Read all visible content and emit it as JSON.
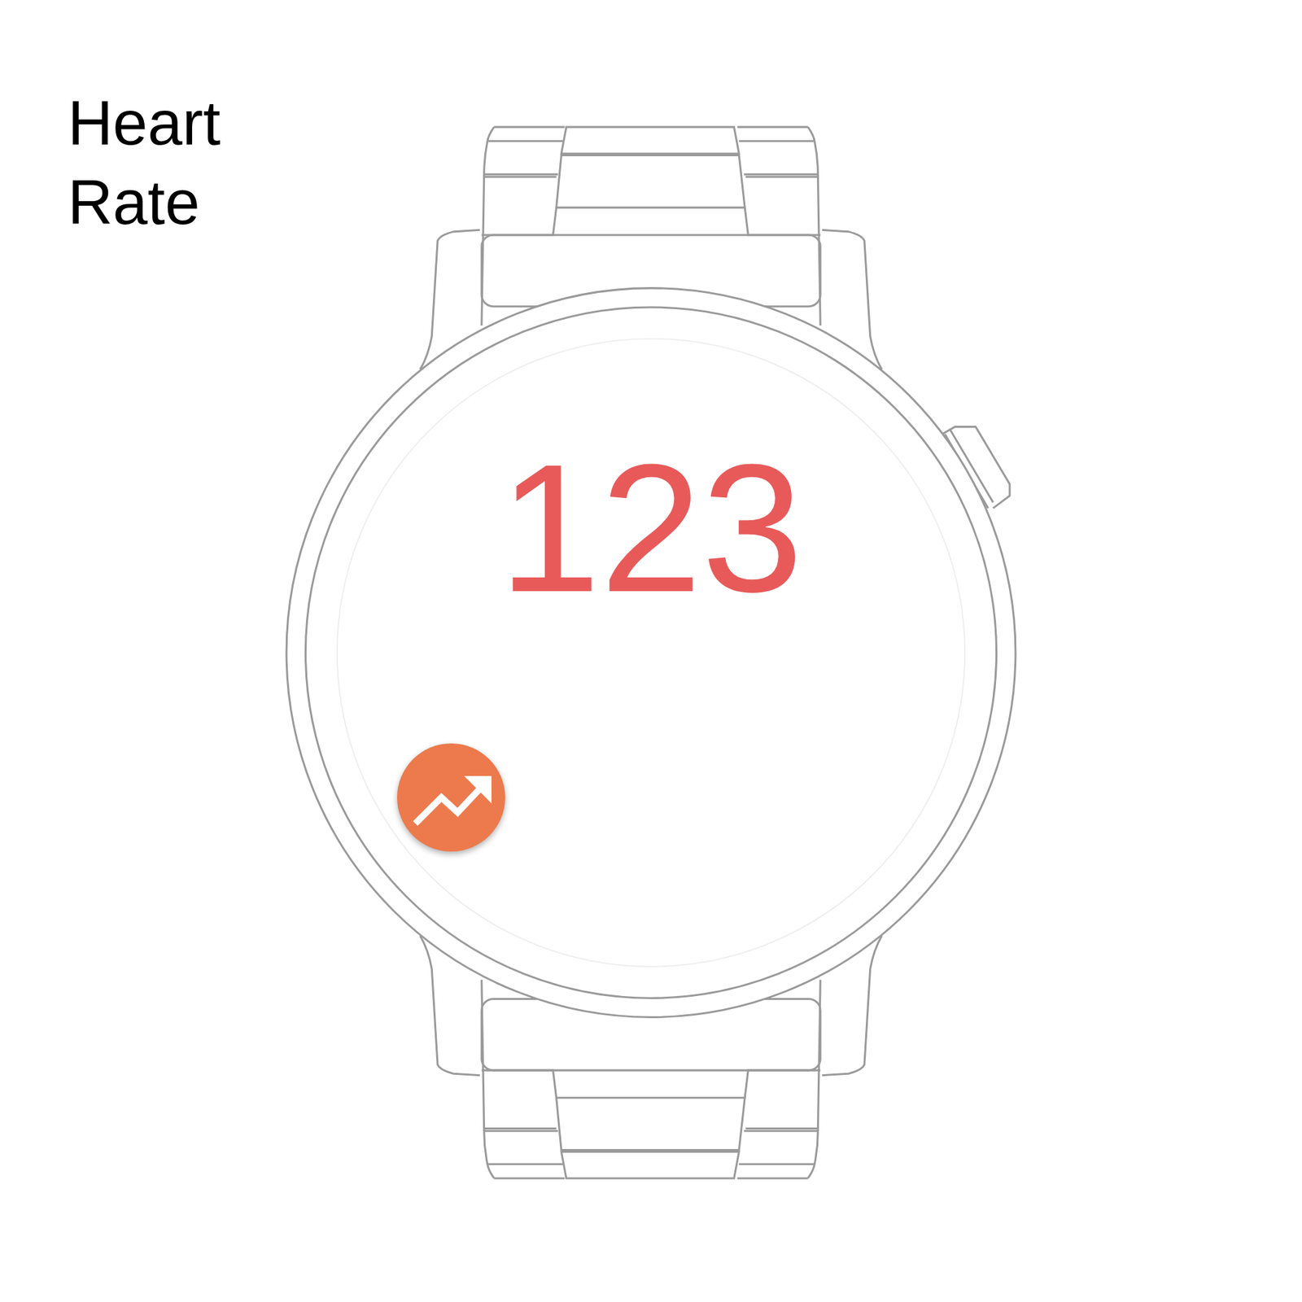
{
  "title": "Heart Rate",
  "heart_rate": {
    "value": "123"
  }
}
